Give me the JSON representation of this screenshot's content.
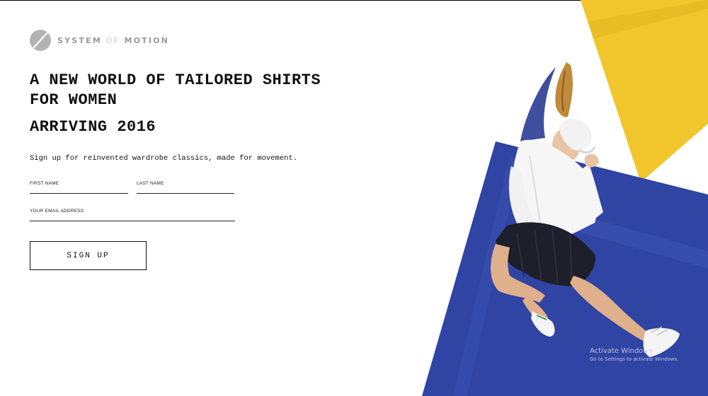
{
  "brand": {
    "name_part1": "SYSTEM",
    "name_of": "OF",
    "name_part2": "MOTION"
  },
  "hero": {
    "headline": "A NEW WORLD OF TAILORED SHIRTS FOR WOMEN",
    "subheadline": "ARRIVING 2016",
    "tagline": "Sign up for reinvented wardrobe classics, made for movement."
  },
  "form": {
    "first_name_label": "FIRST NAME",
    "last_name_label": "LAST NAME",
    "email_label": "YOUR EMAIL ADDRESS",
    "first_name_value": "",
    "last_name_value": "",
    "email_value": "",
    "submit_label": "SIGN UP"
  },
  "watermark": {
    "title": "Activate Windows",
    "subtitle": "Go to Settings to activate Windows."
  },
  "colors": {
    "accent_blue": "#2f44a3",
    "accent_yellow": "#f1c52c",
    "text": "#111111",
    "logo_gray": "#9a9a9a"
  }
}
